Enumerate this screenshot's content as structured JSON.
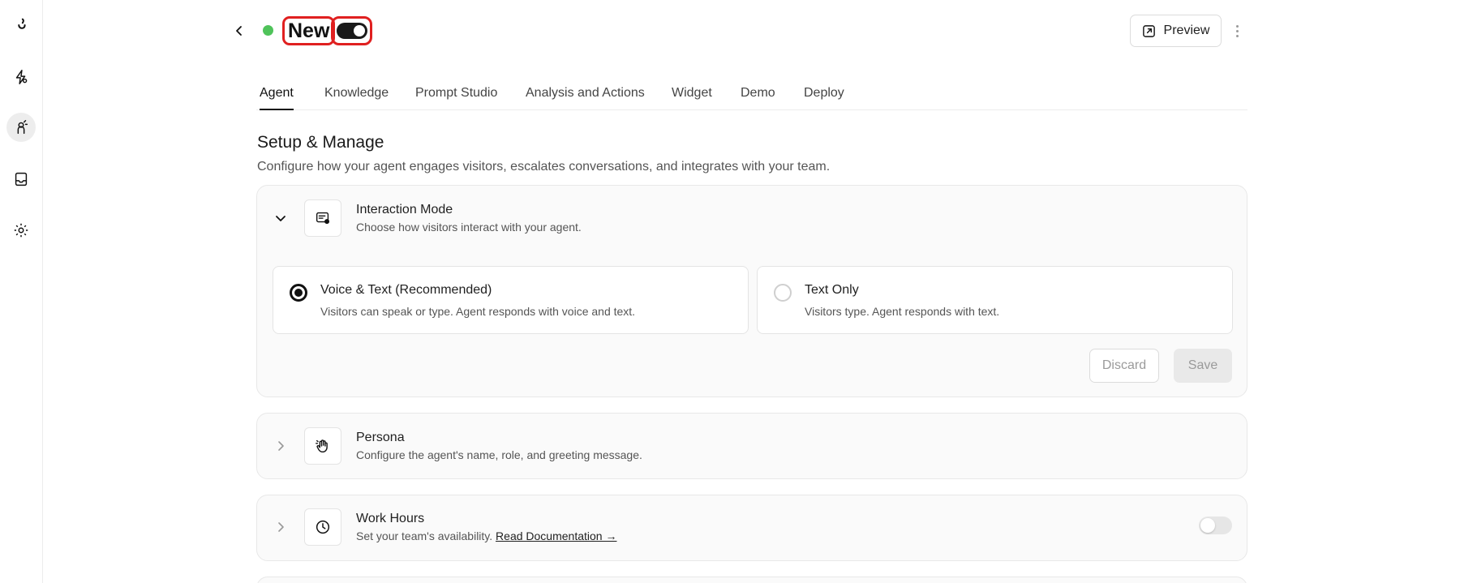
{
  "nav": {
    "items": [
      {
        "icon": "logo-icon"
      },
      {
        "icon": "automation-icon"
      },
      {
        "icon": "agent-icon",
        "active": true
      },
      {
        "icon": "inbox-icon"
      },
      {
        "icon": "gear-icon"
      }
    ]
  },
  "header": {
    "title": "New",
    "status_color": "#4fc35a",
    "enabled": true,
    "preview_label": "Preview"
  },
  "tabs": [
    {
      "label": "Agent",
      "active": true
    },
    {
      "label": "Knowledge"
    },
    {
      "label": "Prompt Studio"
    },
    {
      "label": "Analysis and Actions"
    },
    {
      "label": "Widget"
    },
    {
      "label": "Demo"
    },
    {
      "label": "Deploy"
    }
  ],
  "section": {
    "title": "Setup & Manage",
    "description": "Configure how your agent engages visitors, escalates conversations, and integrates with your team."
  },
  "interaction": {
    "title": "Interaction Mode",
    "description": "Choose how visitors interact with your agent.",
    "expanded": true,
    "options": [
      {
        "title": "Voice & Text (Recommended)",
        "description": "Visitors can speak or type. Agent responds with voice and text.",
        "selected": true
      },
      {
        "title": "Text Only",
        "description": "Visitors type. Agent responds with text.",
        "selected": false
      }
    ],
    "discard_label": "Discard",
    "save_label": "Save"
  },
  "persona": {
    "title": "Persona",
    "description": "Configure the agent's name, role, and greeting message."
  },
  "work_hours": {
    "title": "Work Hours",
    "description": "Set your team's availability.",
    "link_label": "Read Documentation →",
    "enabled": false
  }
}
